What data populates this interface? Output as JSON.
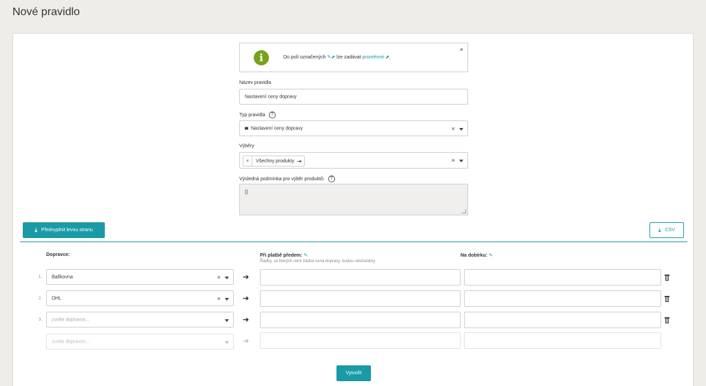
{
  "page": {
    "title": "Nové pravidlo"
  },
  "info": {
    "text_before": "Do polí označených",
    "text_middle": "lze zadávat",
    "link": "proměnné",
    "close": "×"
  },
  "rule_name": {
    "label": "Název pravidla",
    "value": "Nastavení ceny dopravy"
  },
  "rule_type": {
    "label": "Typ pravidla",
    "help": "?",
    "value": "Nastavení ceny dopravy",
    "clear": "×",
    "icon": "truck-icon"
  },
  "selections": {
    "label": "Výběry",
    "chip_remove": "×",
    "chip_label": "Všechny produkty",
    "chip_link": "⇥",
    "clear": "×"
  },
  "condition": {
    "label": "Výsledná podmínka pro výběr produktů:",
    "help": "?",
    "value": "()"
  },
  "buttons": {
    "prefill": "Předvyplnit levou stranu",
    "csv": "CSV",
    "create": "Vytvořit"
  },
  "table": {
    "carrier_header": "Dopravce:",
    "prepaid_header": "Při platbě předem:",
    "prepaid_note": "Řádky, ve kterých není žádná cena dopravy, budou odstraněny",
    "cod_header": "Na dobírku:",
    "pen_icon": "✎",
    "arrow": "➔",
    "rows": [
      {
        "num": "1.",
        "carrier": "Balíkovna",
        "placeholder": "",
        "clear": "×",
        "prepaid": "",
        "cod": ""
      },
      {
        "num": "2.",
        "carrier": "DHL",
        "placeholder": "",
        "clear": "×",
        "prepaid": "",
        "cod": ""
      },
      {
        "num": "3.",
        "carrier": "",
        "placeholder": "zvolte dopravce...",
        "clear": "",
        "prepaid": "",
        "cod": ""
      }
    ],
    "new_row": {
      "placeholder": "zvolte dopravce..."
    }
  },
  "colors": {
    "accent": "#1a9aa6",
    "info_green": "#74a31b",
    "background": "#efede8"
  }
}
